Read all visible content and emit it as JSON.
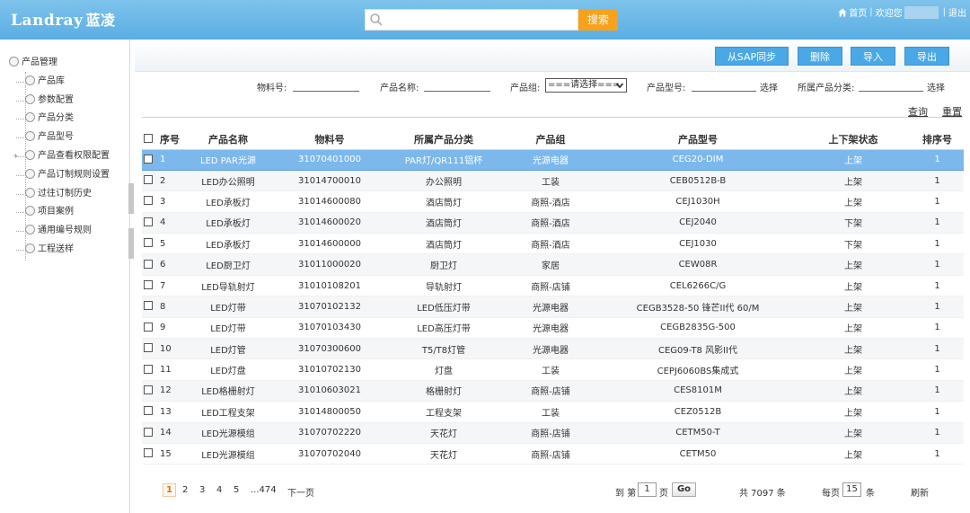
{
  "header": {
    "logo_en": "Landray",
    "logo_cn": "蓝凌",
    "search_placeholder": "",
    "search_button": "搜索",
    "home": "首页",
    "welcome": "欢迎您",
    "logout": "退出",
    "sep1": "|",
    "sep2": "|"
  },
  "sidebar": {
    "root": "产品管理",
    "items": [
      {
        "label": "产品库"
      },
      {
        "label": "参数配置"
      },
      {
        "label": "产品分类"
      },
      {
        "label": "产品型号"
      },
      {
        "label": "产品查看权限配置",
        "expander": "+"
      },
      {
        "label": "产品订制规则设置"
      },
      {
        "label": "过往订制历史"
      },
      {
        "label": "项目案例"
      },
      {
        "label": "通用编号规则"
      },
      {
        "label": "工程送样"
      }
    ]
  },
  "toolbar": {
    "sync": "从SAP同步",
    "delete": "删除",
    "import": "导入",
    "export": "导出"
  },
  "filters": {
    "material_no_label": "物料号:",
    "product_name_label": "产品名称:",
    "product_group_label": "产品组:",
    "product_group_selected": "===请选择===",
    "product_model_label": "产品型号:",
    "product_model_select": "选择",
    "category_label": "所属产品分类:",
    "category_select": "选择",
    "query": "查询",
    "reset": "重置"
  },
  "table": {
    "headers": {
      "no": "序号",
      "name": "产品名称",
      "material": "物料号",
      "category": "所属产品分类",
      "group": "产品组",
      "model": "产品型号",
      "status": "上下架状态",
      "sort": "排序号"
    },
    "rows": [
      {
        "no": "1",
        "name": "LED PAR光源",
        "material": "31070401000",
        "category": "PAR灯/QR111铝杯",
        "group": "光源电器",
        "model": "CEG20-DIM",
        "status": "上架",
        "sort": "1"
      },
      {
        "no": "2",
        "name": "LED办公照明",
        "material": "31014700010",
        "category": "办公照明",
        "group": "工装",
        "model": "CEB0512B-B",
        "status": "上架",
        "sort": "1"
      },
      {
        "no": "3",
        "name": "LED承板灯",
        "material": "31014600080",
        "category": "酒店筒灯",
        "group": "商照-酒店",
        "model": "CEJ1030H",
        "status": "上架",
        "sort": "1"
      },
      {
        "no": "4",
        "name": "LED承板灯",
        "material": "31014600020",
        "category": "酒店筒灯",
        "group": "商照-酒店",
        "model": "CEJ2040",
        "status": "下架",
        "sort": "1"
      },
      {
        "no": "5",
        "name": "LED承板灯",
        "material": "31014600000",
        "category": "酒店筒灯",
        "group": "商照-酒店",
        "model": "CEJ1030",
        "status": "下架",
        "sort": "1"
      },
      {
        "no": "6",
        "name": "LED厨卫灯",
        "material": "31011000020",
        "category": "厨卫灯",
        "group": "家居",
        "model": "CEW08R",
        "status": "上架",
        "sort": "1"
      },
      {
        "no": "7",
        "name": "LED导轨射灯",
        "material": "31010108201",
        "category": "导轨射灯",
        "group": "商照-店铺",
        "model": "CEL6266C/G",
        "status": "上架",
        "sort": "1"
      },
      {
        "no": "8",
        "name": "LED灯带",
        "material": "31070102132",
        "category": "LED低压灯带",
        "group": "光源电器",
        "model": "CEGB3528-50 锋芒II代 60/M",
        "status": "上架",
        "sort": "1"
      },
      {
        "no": "9",
        "name": "LED灯带",
        "material": "31070103430",
        "category": "LED高压灯带",
        "group": "光源电器",
        "model": "CEGB2835G-500",
        "status": "上架",
        "sort": "1"
      },
      {
        "no": "10",
        "name": "LED灯管",
        "material": "31070300600",
        "category": "T5/T8灯管",
        "group": "光源电器",
        "model": "CEG09-T8 风影II代",
        "status": "上架",
        "sort": "1"
      },
      {
        "no": "11",
        "name": "LED灯盘",
        "material": "31010702130",
        "category": "灯盘",
        "group": "工装",
        "model": "CEPJ6060BS集成式",
        "status": "上架",
        "sort": "1"
      },
      {
        "no": "12",
        "name": "LED格栅射灯",
        "material": "31010603021",
        "category": "格栅射灯",
        "group": "商照-店铺",
        "model": "CES8101M",
        "status": "上架",
        "sort": "1"
      },
      {
        "no": "13",
        "name": "LED工程支架",
        "material": "31014800050",
        "category": "工程支架",
        "group": "工装",
        "model": "CEZ0512B",
        "status": "上架",
        "sort": "1"
      },
      {
        "no": "14",
        "name": "LED光源模组",
        "material": "31070702220",
        "category": "天花灯",
        "group": "商照-店铺",
        "model": "CETM50-T",
        "status": "上架",
        "sort": "1"
      },
      {
        "no": "15",
        "name": "LED光源模组",
        "material": "31070702040",
        "category": "天花灯",
        "group": "商照-店铺",
        "model": "CETM50",
        "status": "上架",
        "sort": "1"
      }
    ]
  },
  "pager": {
    "pages": [
      "1",
      "2",
      "3",
      "4",
      "5"
    ],
    "ellipsis_last": "...474",
    "next": "下一页",
    "goto_prefix": "到 第",
    "goto_value": "1",
    "goto_suffix": "页",
    "go": "Go",
    "total": "共 7097 条",
    "per_page_prefix": "每页",
    "per_page_value": "15",
    "per_page_suffix": "条",
    "refresh": "刷新"
  },
  "colors": {
    "header": "#62b3e6",
    "button": "#4aa8e6",
    "search_button": "#f7a21c",
    "selected_row": "#7cb8ec"
  }
}
